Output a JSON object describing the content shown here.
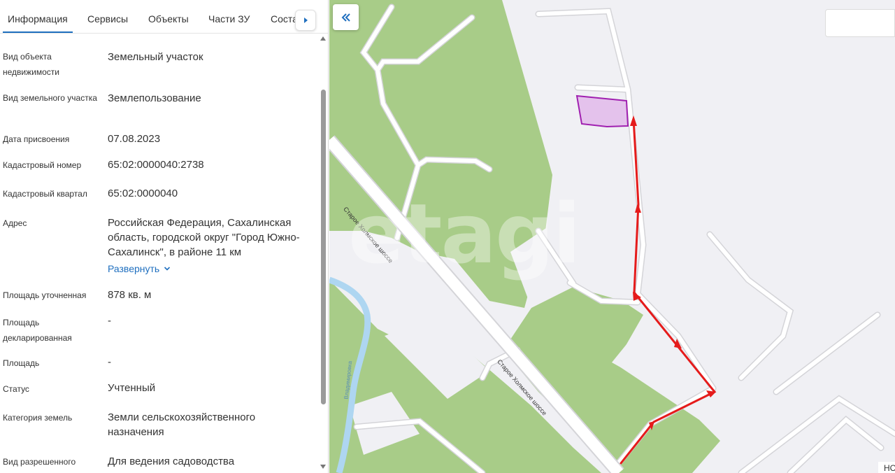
{
  "tabs": [
    {
      "label": "Информация",
      "active": true
    },
    {
      "label": "Сервисы",
      "active": false
    },
    {
      "label": "Объекты",
      "active": false
    },
    {
      "label": "Части ЗУ",
      "active": false
    },
    {
      "label": "Соста",
      "active": false
    }
  ],
  "fields": {
    "object_type": {
      "label": "Вид объекта недвижимости",
      "value": "Земельный участок"
    },
    "parcel_type": {
      "label": "Вид земельного участка",
      "value": "Землепользование"
    },
    "assigned_date": {
      "label": "Дата присвоения",
      "value": "07.08.2023"
    },
    "cadastral_number": {
      "label": "Кадастровый номер",
      "value": "65:02:0000040:2738"
    },
    "cadastral_block": {
      "label": "Кадастровый квартал",
      "value": "65:02:0000040"
    },
    "address": {
      "label": "Адрес",
      "value": "Российская Федерация, Сахалинская область, городской округ \"Город Южно-Сахалинск\", в районе 11 км",
      "expand_label": "Развернуть"
    },
    "area_specified": {
      "label": "Площадь уточненная",
      "value": "878 кв. м"
    },
    "area_declared": {
      "label": "Площадь декларированная",
      "value": "-"
    },
    "area": {
      "label": "Площадь",
      "value": "-"
    },
    "status": {
      "label": "Статус",
      "value": "Учтенный"
    },
    "land_category": {
      "label": "Категория земель",
      "value": "Земли сельскохозяйственного назначения"
    },
    "permitted_use": {
      "label": "Вид разрешенного",
      "value": "Для ведения садоводства"
    }
  },
  "map": {
    "road_label_1": "Старое Холмское шоссе",
    "road_label_2": "Старое Холмское шоссе",
    "river_label": "Владимировка",
    "watermark": "etagi",
    "corner_text": "НС",
    "colors": {
      "forest": "#a8cc88",
      "background": "#f0f0f4",
      "road": "#ffffff",
      "road_edge": "#d4d4d8",
      "river": "#aed6f1",
      "parcel_fill": "#e4c2ec",
      "parcel_stroke": "#a020b0",
      "route_arrow": "#e51b1b"
    },
    "icons": {
      "collapse": "double-chevron-left-icon",
      "tab_next": "triangle-right-icon",
      "expand": "chevron-down-icon"
    }
  }
}
